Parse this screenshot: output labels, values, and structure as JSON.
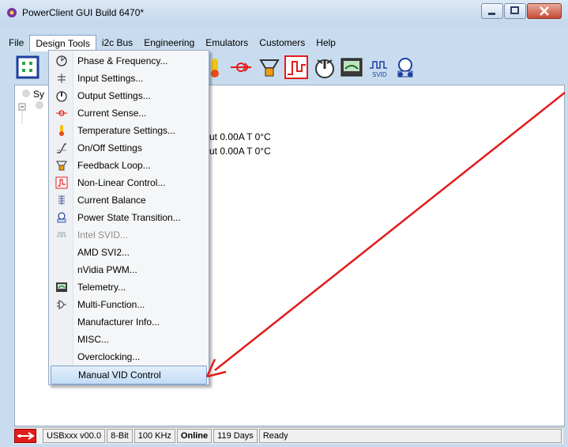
{
  "window": {
    "title": "PowerClient GUI Build 6470*"
  },
  "menubar": {
    "items": [
      "File",
      "Design Tools",
      "i2c Bus",
      "Engineering",
      "Emulators",
      "Customers",
      "Help"
    ]
  },
  "toolbar": {
    "svid_label": "SVID"
  },
  "tree": {
    "root_label": "Sy",
    "row1_value": "ut 0.00A    T 0°C",
    "row2_value": "ut 0.00A    T 0°C"
  },
  "design_tools_menu": {
    "items": [
      {
        "label": "Phase & Frequency...",
        "icon": "phase-frequency-icon",
        "enabled": true
      },
      {
        "label": "Input Settings...",
        "icon": "input-settings-icon",
        "enabled": true
      },
      {
        "label": "Output Settings...",
        "icon": "output-settings-icon",
        "enabled": true
      },
      {
        "label": "Current Sense...",
        "icon": "current-sense-icon",
        "enabled": true
      },
      {
        "label": "Temperature Settings...",
        "icon": "thermometer-icon",
        "enabled": true
      },
      {
        "label": "On/Off Settings",
        "icon": "on-off-icon",
        "enabled": true
      },
      {
        "label": "Feedback Loop...",
        "icon": "feedback-loop-icon",
        "enabled": true
      },
      {
        "label": "Non-Linear Control...",
        "icon": "non-linear-icon",
        "enabled": true
      },
      {
        "label": "Current Balance",
        "icon": "current-balance-icon",
        "enabled": true
      },
      {
        "label": "Power State Transition...",
        "icon": "power-state-icon",
        "enabled": true
      },
      {
        "label": "Intel SVID...",
        "icon": "svid-icon",
        "enabled": false
      },
      {
        "label": "AMD SVI2...",
        "icon": "",
        "enabled": true
      },
      {
        "label": "nVidia PWM...",
        "icon": "",
        "enabled": true
      },
      {
        "label": "Telemetry...",
        "icon": "telemetry-icon",
        "enabled": true
      },
      {
        "label": "Multi-Function...",
        "icon": "multi-function-icon",
        "enabled": true
      },
      {
        "label": "Manufacturer Info...",
        "icon": "",
        "enabled": true
      },
      {
        "label": "MISC...",
        "icon": "",
        "enabled": true
      },
      {
        "label": "Overclocking...",
        "icon": "",
        "enabled": true
      },
      {
        "label": "Manual VID Control",
        "icon": "",
        "enabled": true,
        "highlighted": true
      }
    ]
  },
  "statusbar": {
    "device": "USBxxx v00.0",
    "bits": "8-Bit",
    "speed": "100 KHz",
    "state": "Online",
    "days": "119 Days",
    "message": "Ready"
  },
  "colors": {
    "annotation_arrow": "#e31c1c",
    "highlight": "#c3dcf6"
  }
}
